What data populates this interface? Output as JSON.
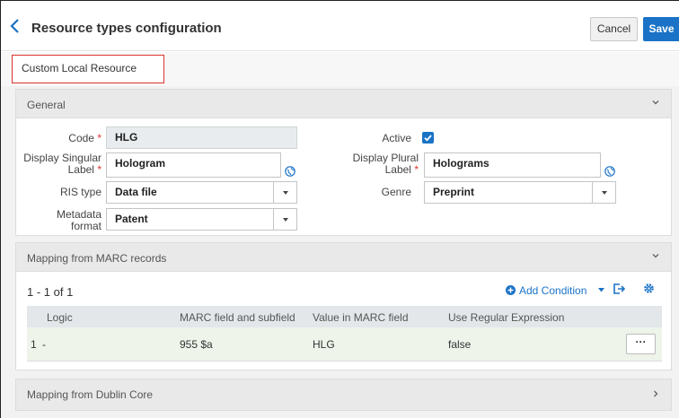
{
  "header": {
    "title": "Resource types configuration",
    "cancel_label": "Cancel",
    "save_label": "Save"
  },
  "tabs": [
    {
      "label": "Custom Local Resource Types",
      "active": true
    }
  ],
  "general": {
    "section_title": "General",
    "code": {
      "label": "Code",
      "value": "HLG"
    },
    "active": {
      "label": "Active",
      "checked": true
    },
    "display_singular": {
      "label_line1": "Display Singular",
      "label_line2": "Label",
      "value": "Hologram"
    },
    "display_plural": {
      "label_line1": "Display Plural",
      "label_line2": "Label",
      "value": "Holograms"
    },
    "ris_type": {
      "label": "RIS type",
      "value": "Data file"
    },
    "genre": {
      "label": "Genre",
      "value": "Preprint"
    },
    "metadata_format": {
      "label_line1": "Metadata",
      "label_line2": "format",
      "value": "Patent"
    }
  },
  "marc": {
    "section_title": "Mapping from MARC records",
    "count": "1 - 1 of 1",
    "add_condition_label": "Add Condition",
    "columns": [
      "Logic",
      "MARC field and subfield",
      "Value in MARC field",
      "Use Regular Expression"
    ],
    "rows": [
      {
        "index": "1",
        "logic": "-",
        "field": "955 $a",
        "value": "HLG",
        "regex": "false",
        "actions": "···"
      }
    ]
  },
  "dublin": {
    "section_title": "Mapping from Dublin Core"
  },
  "required_marker": "*",
  "colors": {
    "accent": "#1a73c6",
    "required": "#d9332e",
    "tab_border": "#d9332e"
  }
}
